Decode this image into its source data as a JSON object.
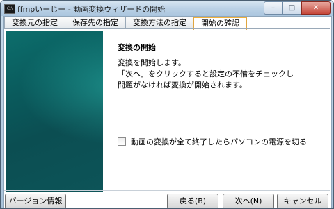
{
  "window": {
    "title": "ffmpいーじー - 動画変換ウィザードの開始",
    "minimize": "–",
    "maximize": "□",
    "close": "✕",
    "icon_text": "C:\\"
  },
  "tabs": [
    {
      "label": "変換元の指定"
    },
    {
      "label": "保存先の指定"
    },
    {
      "label": "変換方法の指定"
    },
    {
      "label": "開始の確認",
      "active": true
    }
  ],
  "main": {
    "heading": "変換の開始",
    "lines": [
      "変換を開始します。",
      "「次へ」をクリックすると設定の不備をチェックし",
      "問題がなければ変換が開始されます。"
    ],
    "checkbox_label": "動画の変換が全て終了したらパソコンの電源を切る",
    "checkbox_checked": false
  },
  "buttons": {
    "version": "バージョン情報",
    "back": "戻る(B)",
    "next": "次へ(N)",
    "cancel": "キャンセル"
  }
}
